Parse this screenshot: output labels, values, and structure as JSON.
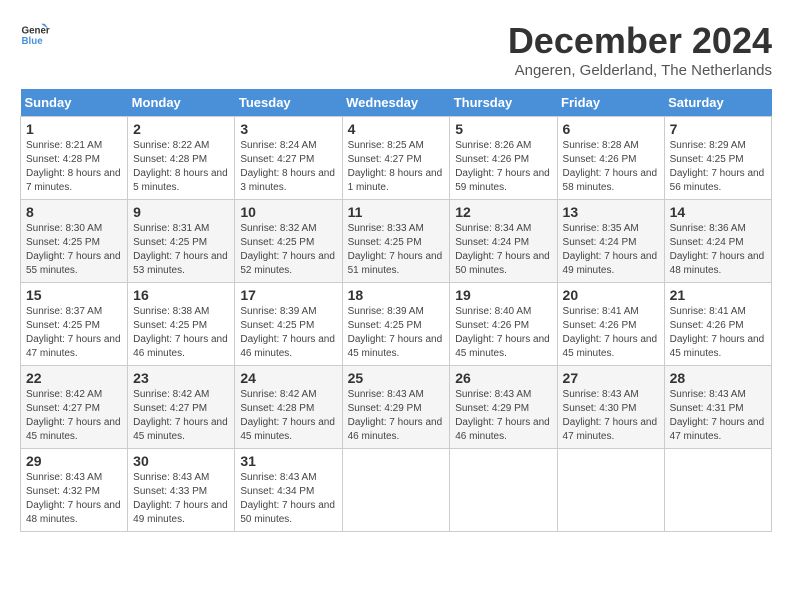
{
  "logo": {
    "line1": "General",
    "line2": "Blue"
  },
  "title": "December 2024",
  "subtitle": "Angeren, Gelderland, The Netherlands",
  "headers": [
    "Sunday",
    "Monday",
    "Tuesday",
    "Wednesday",
    "Thursday",
    "Friday",
    "Saturday"
  ],
  "weeks": [
    [
      {
        "day": "1",
        "sunrise": "8:21 AM",
        "sunset": "4:28 PM",
        "daylight": "8 hours and 7 minutes."
      },
      {
        "day": "2",
        "sunrise": "8:22 AM",
        "sunset": "4:28 PM",
        "daylight": "8 hours and 5 minutes."
      },
      {
        "day": "3",
        "sunrise": "8:24 AM",
        "sunset": "4:27 PM",
        "daylight": "8 hours and 3 minutes."
      },
      {
        "day": "4",
        "sunrise": "8:25 AM",
        "sunset": "4:27 PM",
        "daylight": "8 hours and 1 minute."
      },
      {
        "day": "5",
        "sunrise": "8:26 AM",
        "sunset": "4:26 PM",
        "daylight": "7 hours and 59 minutes."
      },
      {
        "day": "6",
        "sunrise": "8:28 AM",
        "sunset": "4:26 PM",
        "daylight": "7 hours and 58 minutes."
      },
      {
        "day": "7",
        "sunrise": "8:29 AM",
        "sunset": "4:25 PM",
        "daylight": "7 hours and 56 minutes."
      }
    ],
    [
      {
        "day": "8",
        "sunrise": "8:30 AM",
        "sunset": "4:25 PM",
        "daylight": "7 hours and 55 minutes."
      },
      {
        "day": "9",
        "sunrise": "8:31 AM",
        "sunset": "4:25 PM",
        "daylight": "7 hours and 53 minutes."
      },
      {
        "day": "10",
        "sunrise": "8:32 AM",
        "sunset": "4:25 PM",
        "daylight": "7 hours and 52 minutes."
      },
      {
        "day": "11",
        "sunrise": "8:33 AM",
        "sunset": "4:25 PM",
        "daylight": "7 hours and 51 minutes."
      },
      {
        "day": "12",
        "sunrise": "8:34 AM",
        "sunset": "4:24 PM",
        "daylight": "7 hours and 50 minutes."
      },
      {
        "day": "13",
        "sunrise": "8:35 AM",
        "sunset": "4:24 PM",
        "daylight": "7 hours and 49 minutes."
      },
      {
        "day": "14",
        "sunrise": "8:36 AM",
        "sunset": "4:24 PM",
        "daylight": "7 hours and 48 minutes."
      }
    ],
    [
      {
        "day": "15",
        "sunrise": "8:37 AM",
        "sunset": "4:25 PM",
        "daylight": "7 hours and 47 minutes."
      },
      {
        "day": "16",
        "sunrise": "8:38 AM",
        "sunset": "4:25 PM",
        "daylight": "7 hours and 46 minutes."
      },
      {
        "day": "17",
        "sunrise": "8:39 AM",
        "sunset": "4:25 PM",
        "daylight": "7 hours and 46 minutes."
      },
      {
        "day": "18",
        "sunrise": "8:39 AM",
        "sunset": "4:25 PM",
        "daylight": "7 hours and 45 minutes."
      },
      {
        "day": "19",
        "sunrise": "8:40 AM",
        "sunset": "4:26 PM",
        "daylight": "7 hours and 45 minutes."
      },
      {
        "day": "20",
        "sunrise": "8:41 AM",
        "sunset": "4:26 PM",
        "daylight": "7 hours and 45 minutes."
      },
      {
        "day": "21",
        "sunrise": "8:41 AM",
        "sunset": "4:26 PM",
        "daylight": "7 hours and 45 minutes."
      }
    ],
    [
      {
        "day": "22",
        "sunrise": "8:42 AM",
        "sunset": "4:27 PM",
        "daylight": "7 hours and 45 minutes."
      },
      {
        "day": "23",
        "sunrise": "8:42 AM",
        "sunset": "4:27 PM",
        "daylight": "7 hours and 45 minutes."
      },
      {
        "day": "24",
        "sunrise": "8:42 AM",
        "sunset": "4:28 PM",
        "daylight": "7 hours and 45 minutes."
      },
      {
        "day": "25",
        "sunrise": "8:43 AM",
        "sunset": "4:29 PM",
        "daylight": "7 hours and 46 minutes."
      },
      {
        "day": "26",
        "sunrise": "8:43 AM",
        "sunset": "4:29 PM",
        "daylight": "7 hours and 46 minutes."
      },
      {
        "day": "27",
        "sunrise": "8:43 AM",
        "sunset": "4:30 PM",
        "daylight": "7 hours and 47 minutes."
      },
      {
        "day": "28",
        "sunrise": "8:43 AM",
        "sunset": "4:31 PM",
        "daylight": "7 hours and 47 minutes."
      }
    ],
    [
      {
        "day": "29",
        "sunrise": "8:43 AM",
        "sunset": "4:32 PM",
        "daylight": "7 hours and 48 minutes."
      },
      {
        "day": "30",
        "sunrise": "8:43 AM",
        "sunset": "4:33 PM",
        "daylight": "7 hours and 49 minutes."
      },
      {
        "day": "31",
        "sunrise": "8:43 AM",
        "sunset": "4:34 PM",
        "daylight": "7 hours and 50 minutes."
      },
      null,
      null,
      null,
      null
    ]
  ]
}
